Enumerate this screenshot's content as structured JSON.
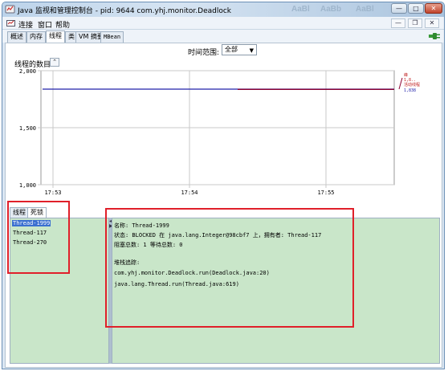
{
  "window": {
    "title": "Java 监视和管理控制台 - pid: 9644 com.yhj.monitor.Deadlock",
    "ghost_text": [
      "AaBl",
      "AaBb",
      "AaBl"
    ]
  },
  "menu": {
    "items": [
      "连接",
      "窗口",
      "帮助"
    ]
  },
  "tabs": [
    "概述",
    "内存",
    "线程",
    "类",
    "VM 摘要",
    "MBean"
  ],
  "active_tab": "线程",
  "time_range": {
    "label": "时间范围:",
    "value": "全部"
  },
  "chart_section": {
    "title": "线程的数目"
  },
  "chart_data": {
    "type": "line",
    "x_ticks": [
      "17:53",
      "17:54",
      "17:55"
    ],
    "y_ticks": [
      "2,000",
      "1,500",
      "1,000"
    ],
    "ylim": [
      1000,
      2000
    ],
    "series": [
      {
        "name": "活动线程",
        "color": "#2222aa",
        "x": [
          "17:53",
          "17:55"
        ],
        "values": [
          1838,
          1838
        ]
      },
      {
        "name": "峰",
        "color": "#8b0030",
        "x": [
          "17:54",
          "17:55"
        ],
        "values": [
          1836,
          1836
        ]
      }
    ],
    "legend": {
      "peak_label": "峰",
      "peak_value": "1,8..",
      "live_label": "活动线程",
      "live_value": "1,838"
    },
    "grid": true
  },
  "subtabs": [
    "线程",
    "死锁"
  ],
  "active_subtab": "死锁",
  "threads": [
    "Thread-1999",
    "Thread-117",
    "Thread-270"
  ],
  "selected_thread": "Thread-1999",
  "details": {
    "name_line": "名称:  Thread-1999",
    "state_line": "状态: BLOCKED 在 java.lang.Integer@98cbf7 上，拥有者:  Thread-117",
    "count_line": "阻塞总数: 1   等待总数:  0",
    "stack_title": "堆栈追踪:",
    "stack": [
      "com.yhj.monitor.Deadlock.run(Deadlock.java:20)",
      "java.lang.Thread.run(Thread.java:619)"
    ]
  }
}
